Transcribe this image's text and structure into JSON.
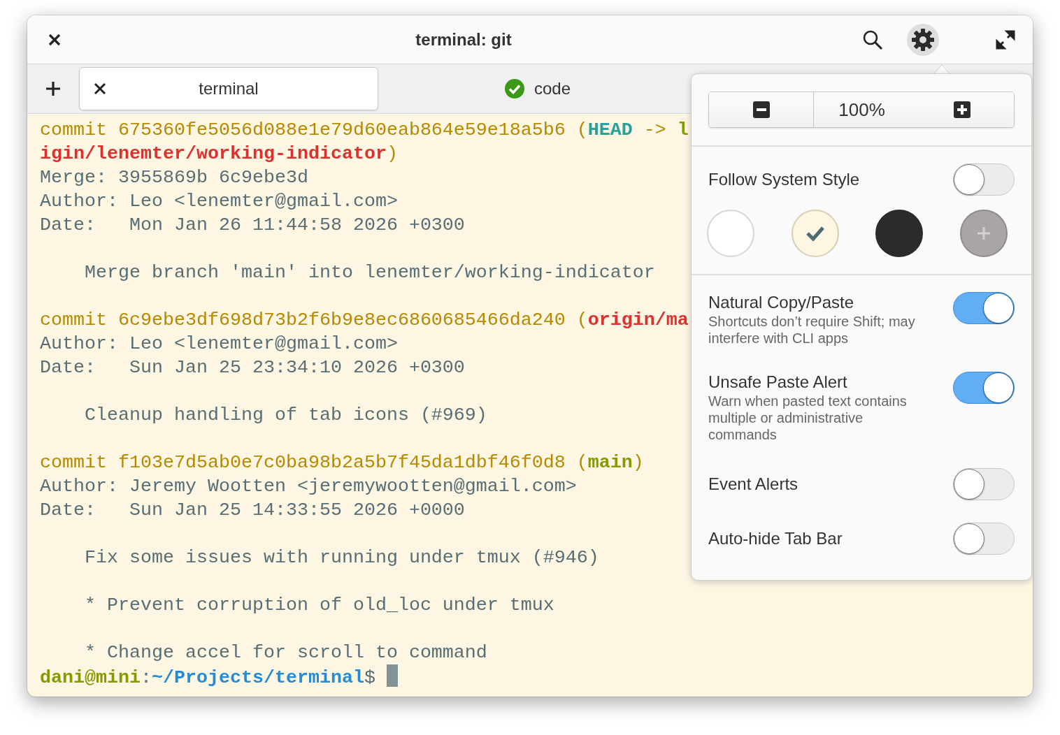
{
  "window": {
    "title": "terminal: git",
    "header_buttons": [
      {
        "kind": "search",
        "selected": false
      },
      {
        "kind": "settings",
        "selected": true
      },
      {
        "kind": "maximize",
        "selected": false
      }
    ]
  },
  "tabs": [
    {
      "label": "terminal",
      "selected": true,
      "kind": "closable"
    },
    {
      "label": "code",
      "selected": false,
      "kind": "status"
    }
  ],
  "terminal": {
    "lines": [
      {
        "kind": "text",
        "segments": [
          {
            "kind": "commit",
            "text": "commit 675360fe5056d088e1e79d60eab864e59e18a5b6 ("
          },
          {
            "kind": "head",
            "text": "HEAD"
          },
          {
            "kind": "commit",
            "text": " -> "
          },
          {
            "kind": "local",
            "text": "l"
          }
        ]
      },
      {
        "kind": "text",
        "segments": [
          {
            "kind": "remote",
            "text": "igin/lenemter/working-indicator"
          },
          {
            "kind": "commit",
            "text": ")"
          }
        ]
      },
      {
        "kind": "text",
        "segments": [
          {
            "kind": "plain",
            "text": "Merge: 3955869b 6c9ebe3d"
          }
        ]
      },
      {
        "kind": "text",
        "segments": [
          {
            "kind": "plain",
            "text": "Author: Leo <lenemter@gmail.com>"
          }
        ]
      },
      {
        "kind": "text",
        "segments": [
          {
            "kind": "plain",
            "text": "Date:   Mon Jan 26 11:44:58 2026 +0300"
          }
        ]
      },
      {
        "kind": "blank"
      },
      {
        "kind": "text",
        "segments": [
          {
            "kind": "plain",
            "text": "    Merge branch 'main' into lenemter/working-indicator"
          }
        ]
      },
      {
        "kind": "blank"
      },
      {
        "kind": "text",
        "segments": [
          {
            "kind": "commit",
            "text": "commit 6c9ebe3df698d73b2f6b9e8ec6860685466da240 ("
          },
          {
            "kind": "remote",
            "text": "origin/ma"
          }
        ]
      },
      {
        "kind": "text",
        "segments": [
          {
            "kind": "plain",
            "text": "Author: Leo <lenemter@gmail.com>"
          }
        ]
      },
      {
        "kind": "text",
        "segments": [
          {
            "kind": "plain",
            "text": "Date:   Sun Jan 25 23:34:10 2026 +0300"
          }
        ]
      },
      {
        "kind": "blank"
      },
      {
        "kind": "text",
        "segments": [
          {
            "kind": "plain",
            "text": "    Cleanup handling of tab icons (#969)"
          }
        ]
      },
      {
        "kind": "blank"
      },
      {
        "kind": "text",
        "segments": [
          {
            "kind": "commit",
            "text": "commit f103e7d5ab0e7c0ba98b2a5b7f45da1dbf46f0d8 ("
          },
          {
            "kind": "local",
            "text": "main"
          },
          {
            "kind": "commit",
            "text": ")"
          }
        ]
      },
      {
        "kind": "text",
        "segments": [
          {
            "kind": "plain",
            "text": "Author: Jeremy Wootten <jeremywootten@gmail.com>"
          }
        ]
      },
      {
        "kind": "text",
        "segments": [
          {
            "kind": "plain",
            "text": "Date:   Sun Jan 25 14:33:55 2026 +0000"
          }
        ]
      },
      {
        "kind": "blank"
      },
      {
        "kind": "text",
        "segments": [
          {
            "kind": "plain",
            "text": "    Fix some issues with running under tmux (#946)"
          }
        ]
      },
      {
        "kind": "blank"
      },
      {
        "kind": "text",
        "segments": [
          {
            "kind": "plain",
            "text": "    * Prevent corruption of old_loc under tmux"
          }
        ]
      },
      {
        "kind": "blank"
      },
      {
        "kind": "text",
        "segments": [
          {
            "kind": "plain",
            "text": "    * Change accel for scroll to command"
          }
        ]
      },
      {
        "kind": "prompt",
        "segments": [
          {
            "kind": "local",
            "text": "dani@mini"
          },
          {
            "kind": "plain",
            "text": ":"
          },
          {
            "kind": "path",
            "text": "~/Projects/terminal"
          },
          {
            "kind": "plain",
            "text": "$ "
          }
        ]
      }
    ]
  },
  "settings": {
    "zoom": {
      "value": "100%"
    },
    "follow_system_style": {
      "label": "Follow System Style",
      "on": false
    },
    "styles": [
      {
        "kind": "swatch",
        "color": "#ffffff",
        "selected": false
      },
      {
        "kind": "swatch",
        "color": "#fdf6e3",
        "selected": true
      },
      {
        "kind": "swatch",
        "color": "#2b2b2b",
        "selected": false
      },
      {
        "kind": "custom",
        "color": "#aaa5a5",
        "selected": false
      }
    ],
    "options": [
      {
        "label": "Natural Copy/Paste",
        "description": "Shortcuts don’t require Shift; may interfere with CLI apps",
        "on": true
      },
      {
        "label": "Unsafe Paste Alert",
        "description": "Warn when pasted text contains multiple or administrative commands",
        "on": true
      },
      {
        "label": "Event Alerts",
        "on": false
      },
      {
        "label": "Auto-hide Tab Bar",
        "on": false
      }
    ]
  }
}
